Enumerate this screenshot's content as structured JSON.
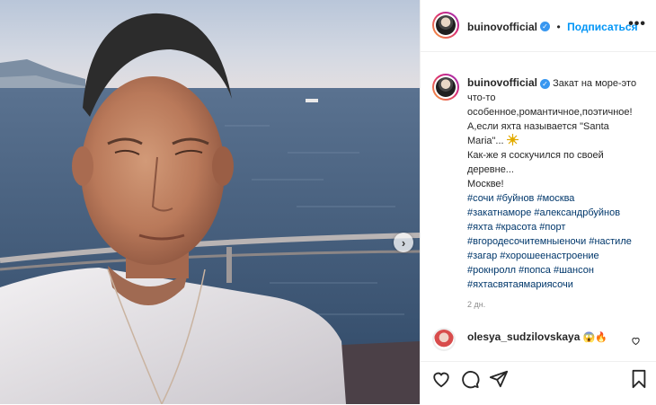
{
  "post": {
    "username": "buinovofficial",
    "follow_label": "Подписаться",
    "separator": "•",
    "more_label": "•••",
    "next_label": "›"
  },
  "caption": {
    "username": "buinovofficial",
    "lines": [
      "Закат на море-это",
      "что-то",
      "особенное,романтичное,поэтичное!",
      "А,если яхта называется \"Santa",
      "Maria\"...",
      "Как-же я соскучился по своей",
      "деревне...",
      "Москве!"
    ],
    "hashtag_lines": [
      "#сочи #буйнов #москва",
      "#закатнаморе #александрбуйнов",
      "#яхта #красота #порт",
      "#вгородесочитемныеночи #настиле",
      "#загар #хорошеенастроение",
      "#рокнролл #попса #шансон",
      "#яхтасвятаямариясочи"
    ],
    "time": "2 дн."
  },
  "comment": {
    "username": "olesya_sudzilovskaya",
    "text": "😱🔥"
  },
  "icons": {
    "like": "heart-icon",
    "comment": "comment-icon",
    "share": "share-icon",
    "save": "bookmark-icon",
    "verified": "verified-badge-icon",
    "sparkle": "sparkle-icon"
  },
  "colors": {
    "link": "#0095f6",
    "hashtag": "#00376b",
    "verified": "#3897f0",
    "muted": "#8e8e8e"
  }
}
